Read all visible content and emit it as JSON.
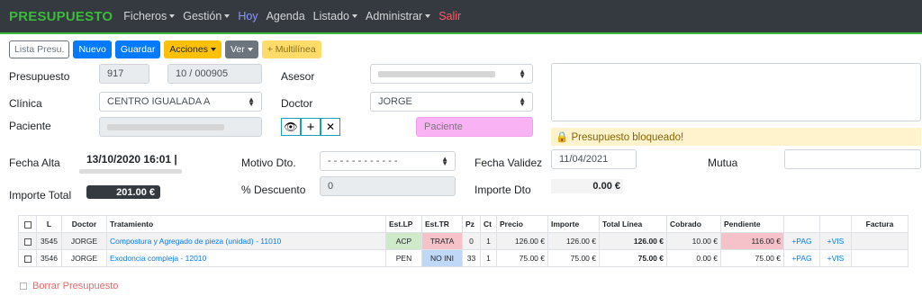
{
  "nav": {
    "brand": "PRESUPUESTO",
    "items": [
      {
        "label": "Ficheros",
        "caret": true
      },
      {
        "label": "Gestión",
        "caret": true
      },
      {
        "label": "Hoy",
        "caret": false
      },
      {
        "label": "Agenda",
        "caret": false
      },
      {
        "label": "Listado",
        "caret": true
      },
      {
        "label": "Administrar",
        "caret": true
      },
      {
        "label": "Salir",
        "caret": false
      }
    ]
  },
  "toolbar": {
    "lista": "Lista Presu.",
    "nuevo": "Nuevo",
    "guardar": "Guardar",
    "acciones": "Acciones",
    "ver": "Ver",
    "multilinea": "+ Multilínea"
  },
  "form": {
    "presupuesto_label": "Presupuesto",
    "presupuesto_num": "917",
    "presupuesto_ref": "10 / 000905",
    "asesor_label": "Asesor",
    "clinica_label": "Clínica",
    "clinica_value": "CENTRO IGUALADA A",
    "doctor_label": "Doctor",
    "doctor_value": "JORGE",
    "paciente_label": "Paciente",
    "paciente_placeholder": "Paciente",
    "bloqueado": "🔒 Presupuesto bloqueado!",
    "fecha_alta_label": "Fecha Alta",
    "fecha_alta_value": "13/10/2020 16:01 |",
    "motivo_label": "Motivo Dto.",
    "motivo_value": "- - - - - - - - - - - -",
    "fecha_validez_label": "Fecha Validez",
    "fecha_validez_value": "11/04/2021",
    "mutua_label": "Mutua",
    "importe_total_label": "Importe Total",
    "importe_total_value": "201.00 €",
    "descuento_label": "% Descuento",
    "descuento_value": "0",
    "importe_dto_label": "Importe Dto",
    "importe_dto_value": "0.00 €"
  },
  "table": {
    "headers": [
      "",
      "L",
      "Doctor",
      "Tratamiento",
      "Est.LP",
      "Est.TR",
      "Pz",
      "Ct",
      "Precio",
      "Importe",
      "Total Línea",
      "Cobrado",
      "Pendiente",
      "",
      "",
      "Factura"
    ],
    "rows": [
      {
        "l": "3545",
        "doctor": "JORGE",
        "tratamiento": "Compostura y Agregado de pieza (unidad) - 11010",
        "est_lp": "ACP",
        "est_tr": "TRATA",
        "pz": "0",
        "ct": "1",
        "precio": "126.00 €",
        "importe": "126.00 €",
        "total": "126.00 €",
        "cobrado": "10.00 €",
        "pendiente": "116.00 €",
        "pag": "+PAG",
        "vis": "+VIS",
        "factura": ""
      },
      {
        "l": "3546",
        "doctor": "JORGE",
        "tratamiento": "Exodoncia compleja - 12010",
        "est_lp": "PEN",
        "est_tr": "NO INI",
        "pz": "33",
        "ct": "1",
        "precio": "75.00 €",
        "importe": "75.00 €",
        "total": "75.00 €",
        "cobrado": "0.00 €",
        "pendiente": "75.00 €",
        "pag": "+PAG",
        "vis": "+VIS",
        "factura": ""
      }
    ]
  },
  "borrar": "Borrar Presupuesto"
}
